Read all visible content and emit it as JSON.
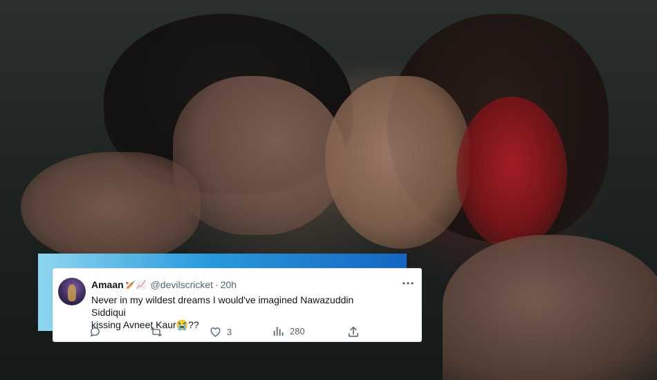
{
  "tweet": {
    "author_name": "Amaan",
    "author_emojis": "🏏📈",
    "handle": "@devilscricket",
    "separator": "·",
    "time": "20h",
    "text_line1": "Never in my wildest dreams I would've imagined Nawazuddin Siddiqui",
    "text_line2": "kissing Avneet Kaur😭??",
    "reply_count": "",
    "retweet_count": "",
    "like_count": "3",
    "view_count": "280",
    "icons": {
      "reply": "reply-icon",
      "retweet": "retweet-icon",
      "like": "like-icon",
      "views": "views-icon",
      "share": "share-icon",
      "more": "more-icon"
    }
  },
  "colors": {
    "card_bg": "#ffffff",
    "text_primary": "#0f1419",
    "text_secondary": "#536471",
    "accent_bar_start": "#8fd7ef",
    "accent_bar_end": "#1565c0"
  }
}
